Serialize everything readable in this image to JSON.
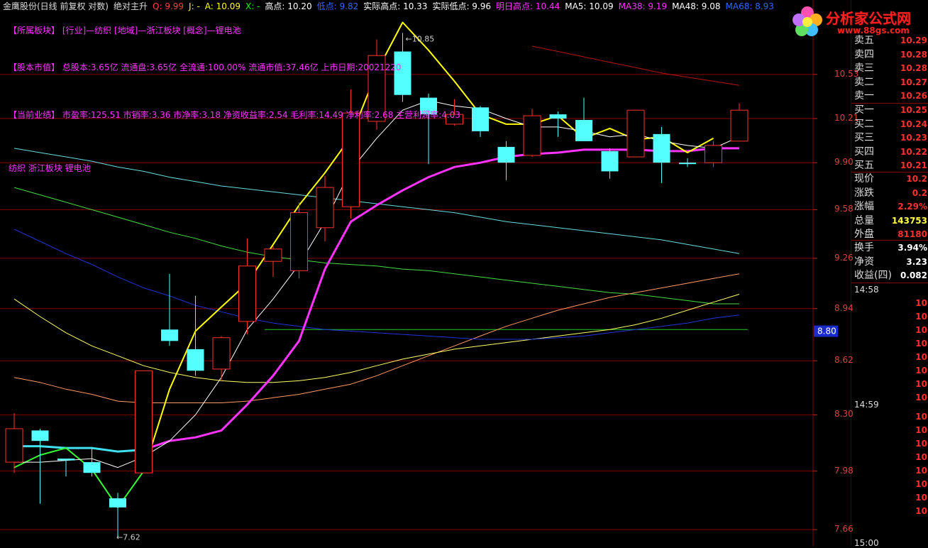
{
  "window": {
    "title": "金鹰股份(日线 前复权 对数)",
    "indicator": "绝对主升"
  },
  "legend": [
    {
      "text": "Q: 9.99",
      "color": "#ff4040"
    },
    {
      "text": "J: -",
      "color": "#ffff00"
    },
    {
      "text": "A: 10.09",
      "color": "#ffff00"
    },
    {
      "text": "X: -",
      "color": "#00ff00"
    },
    {
      "text": "高点: 10.20",
      "color": "#ffffff"
    },
    {
      "text": "低点: 9.82",
      "color": "#3366ff"
    },
    {
      "text": "实际高点: 10.33",
      "color": "#ffffff"
    },
    {
      "text": "实际低点: 9.96",
      "color": "#ffffff"
    },
    {
      "text": "明日高点: 10.44",
      "color": "#ff33ff"
    },
    {
      "text": "MA5: 10.09",
      "color": "#ffffff"
    },
    {
      "text": "MA38: 9.19",
      "color": "#ff33ff"
    },
    {
      "text": "MA48: 9.08",
      "color": "#ffffff"
    },
    {
      "text": "MA68: 8.93",
      "color": "#3366ff"
    }
  ],
  "info": [
    "【所属板块】 [行业]—纺织 [地域]—浙江板块 [概念]—锂电池",
    "【股本市值】 总股本:3.65亿 流通盘:3.65亿 全流通:100.00% 流通市值:37.46亿 上市日期:20021220",
    "【当前业绩】 市盈率:125.51 市销率:3.36 市净率:3.18 净资收益率:2.54 毛利率:14.49 净利率:2.68 主营利润率:4.03",
    "纺织 浙江板块 锂电池"
  ],
  "price_axis": {
    "ticks": [
      "10.53",
      "10.21",
      "9.90",
      "9.58",
      "9.26",
      "8.94",
      "8.62",
      "8.30",
      "7.98",
      "7.66"
    ],
    "current": "8.80"
  },
  "annotations": {
    "high": "10.85",
    "low": "7.62"
  },
  "side_panel": {
    "asks": [
      {
        "label": "卖五",
        "value": "10.29"
      },
      {
        "label": "卖四",
        "value": "10.28"
      },
      {
        "label": "卖三",
        "value": "10.28"
      },
      {
        "label": "卖二",
        "value": "10.27"
      },
      {
        "label": "卖一",
        "value": "10.26"
      }
    ],
    "bids": [
      {
        "label": "买一",
        "value": "10.25"
      },
      {
        "label": "买二",
        "value": "10.24"
      },
      {
        "label": "买三",
        "value": "10.23"
      },
      {
        "label": "买四",
        "value": "10.22"
      },
      {
        "label": "买五",
        "value": "10.21"
      }
    ],
    "stats": [
      {
        "label": "现价",
        "value": "10.2"
      },
      {
        "label": "涨跌",
        "value": "0.2"
      },
      {
        "label": "涨幅",
        "value": "2.29%"
      },
      {
        "label": "总量",
        "value": "143753"
      },
      {
        "label": "外盘",
        "value": "81180"
      },
      {
        "label": "换手",
        "value": "3.94%"
      },
      {
        "label": "净资",
        "value": "3.23"
      },
      {
        "label": "收益(四)",
        "value": "0.082"
      }
    ],
    "time1": "14:58",
    "time2": "14:59",
    "time3": "15:00",
    "ticks": [
      "10",
      "10",
      "10",
      "10",
      "10",
      "10",
      "10",
      "10",
      "10",
      "10",
      "10",
      "10",
      "10",
      "10",
      "10",
      "10",
      "10",
      "10",
      "10",
      "10"
    ]
  },
  "logo": {
    "title": "分析家公式网",
    "url": "www.88gs.com"
  },
  "colors": {
    "up": "#ff3030",
    "down": "#54ffff",
    "ma5": "#ffffff",
    "ma_main": "#ffff00",
    "ma38": "#ff33ff",
    "grid": "#8b0000"
  },
  "chart_data": {
    "type": "candlestick",
    "yscale": "log",
    "ylim": [
      7.6,
      10.95
    ],
    "candles": [
      {
        "o": 8.03,
        "h": 8.31,
        "l": 7.97,
        "c": 8.22,
        "up": true
      },
      {
        "o": 8.21,
        "h": 8.22,
        "l": 7.8,
        "c": 8.15,
        "up": false
      },
      {
        "o": 8.05,
        "h": 8.05,
        "l": 7.95,
        "c": 8.04,
        "up": false
      },
      {
        "o": 8.03,
        "h": 8.11,
        "l": 7.95,
        "c": 7.97,
        "up": false
      },
      {
        "o": 7.83,
        "h": 7.86,
        "l": 7.62,
        "c": 7.78,
        "up": false
      },
      {
        "o": 7.97,
        "h": 8.56,
        "l": 7.97,
        "c": 8.56,
        "up": true
      },
      {
        "o": 8.81,
        "h": 9.16,
        "l": 8.71,
        "c": 8.74,
        "up": false
      },
      {
        "o": 8.69,
        "h": 9.02,
        "l": 8.53,
        "c": 8.56,
        "up": false
      },
      {
        "o": 8.57,
        "h": 8.77,
        "l": 8.5,
        "c": 8.76,
        "up": true
      },
      {
        "o": 8.86,
        "h": 9.39,
        "l": 8.78,
        "c": 9.21,
        "up": true
      },
      {
        "o": 9.24,
        "h": 9.34,
        "l": 9.14,
        "c": 9.32,
        "up": true
      },
      {
        "o": 9.18,
        "h": 9.63,
        "l": 9.13,
        "c": 9.56,
        "up": true
      },
      {
        "o": 9.46,
        "h": 9.81,
        "l": 9.37,
        "c": 9.73,
        "up": true
      },
      {
        "o": 9.6,
        "h": 10.42,
        "l": 9.52,
        "c": 10.25,
        "up": true
      },
      {
        "o": 10.19,
        "h": 10.79,
        "l": 10.13,
        "c": 10.67,
        "up": true
      },
      {
        "o": 10.7,
        "h": 10.84,
        "l": 10.33,
        "c": 10.38,
        "up": false
      },
      {
        "o": 10.36,
        "h": 10.39,
        "l": 9.89,
        "c": 10.24,
        "up": false
      },
      {
        "o": 10.24,
        "h": 10.35,
        "l": 10.16,
        "c": 10.17,
        "up": true
      },
      {
        "o": 10.29,
        "h": 10.3,
        "l": 10.08,
        "c": 10.12,
        "up": false
      },
      {
        "o": 10.01,
        "h": 10.05,
        "l": 9.78,
        "c": 9.9,
        "up": false
      },
      {
        "o": 9.95,
        "h": 10.28,
        "l": 9.94,
        "c": 10.23,
        "up": true
      },
      {
        "o": 10.24,
        "h": 10.26,
        "l": 10.08,
        "c": 10.21,
        "up": false
      },
      {
        "o": 10.2,
        "h": 10.36,
        "l": 10.08,
        "c": 10.05,
        "up": false
      },
      {
        "o": 9.98,
        "h": 10.0,
        "l": 9.79,
        "c": 9.84,
        "up": false
      },
      {
        "o": 10.27,
        "h": 10.27,
        "l": 9.94,
        "c": 9.94,
        "up": true
      },
      {
        "o": 10.1,
        "h": 10.15,
        "l": 9.76,
        "c": 9.9,
        "up": false
      },
      {
        "o": 9.9,
        "h": 9.93,
        "l": 9.87,
        "c": 9.89,
        "up": false
      },
      {
        "o": 9.9,
        "h": 10.05,
        "l": 9.87,
        "c": 10.02,
        "up": true
      },
      {
        "o": 10.05,
        "h": 10.32,
        "l": 10.05,
        "c": 10.27,
        "up": true
      }
    ],
    "lines": [
      {
        "name": "MA5",
        "color": "#ffffff",
        "width": 1,
        "values": [
          8.03,
          8.03,
          8.04,
          8.05,
          8.0,
          8.06,
          8.15,
          8.3,
          8.52,
          8.81,
          9.0,
          9.22,
          9.5,
          9.85,
          10.07,
          10.27,
          10.34,
          10.3,
          10.28,
          10.21,
          10.15,
          10.15,
          10.12,
          10.08,
          10.1,
          10.05,
          10.02,
          10.0,
          10.08
        ]
      },
      {
        "name": "主升线",
        "color": "#ffff00",
        "width": 2,
        "values": [
          null,
          null,
          null,
          null,
          null,
          7.98,
          8.45,
          8.8,
          8.95,
          9.1,
          9.35,
          9.61,
          9.83,
          10.08,
          10.55,
          10.92,
          10.71,
          10.48,
          10.24,
          10.17,
          10.17,
          10.23,
          10.07,
          10.14,
          10.06,
          10.08,
          9.97,
          10.07,
          null
        ]
      },
      {
        "name": "MA38",
        "color": "#ff33ff",
        "width": 3,
        "values": [
          null,
          null,
          null,
          null,
          null,
          8.1,
          8.15,
          8.17,
          8.21,
          8.36,
          8.53,
          8.74,
          9.19,
          9.5,
          9.61,
          9.71,
          9.8,
          9.87,
          9.9,
          9.94,
          9.96,
          9.97,
          9.99,
          9.99,
          9.99,
          9.98,
          9.98,
          10.0,
          10.0
        ]
      },
      {
        "name": "绿线",
        "color": "#33ff33",
        "width": 2,
        "values": [
          8.0,
          8.07,
          8.11,
          7.99,
          7.78,
          7.98,
          null,
          null,
          null,
          null,
          null,
          null,
          null,
          null,
          null,
          null,
          null,
          null,
          null,
          null,
          null,
          null,
          null,
          null,
          null,
          null,
          null,
          null,
          null
        ]
      },
      {
        "name": "青线",
        "color": "#40e0f0",
        "width": 3,
        "values": [
          8.12,
          8.12,
          8.11,
          8.11,
          8.09,
          8.1,
          null,
          null,
          null,
          null,
          null,
          null,
          null,
          null,
          null,
          null,
          null,
          null,
          null,
          null,
          null,
          null,
          null,
          null,
          null,
          null,
          null,
          null,
          null
        ]
      },
      {
        "name": "MA68",
        "color": "#2233dd",
        "width": 1,
        "values": [
          9.45,
          9.37,
          9.29,
          9.22,
          9.14,
          9.07,
          9.02,
          8.96,
          8.92,
          8.88,
          8.85,
          8.83,
          8.81,
          8.8,
          8.79,
          8.78,
          8.77,
          8.76,
          8.75,
          8.75,
          8.75,
          8.76,
          8.77,
          8.79,
          8.81,
          8.83,
          8.85,
          8.88,
          8.9
        ]
      },
      {
        "name": "MA48",
        "color": "#ffff66",
        "width": 1,
        "values": [
          9.0,
          8.89,
          8.79,
          8.71,
          8.65,
          8.59,
          8.55,
          8.52,
          8.5,
          8.49,
          8.49,
          8.5,
          8.52,
          8.55,
          8.59,
          8.63,
          8.66,
          8.69,
          8.71,
          8.73,
          8.75,
          8.77,
          8.79,
          8.81,
          8.84,
          8.88,
          8.93,
          8.98,
          9.03
        ]
      },
      {
        "name": "橙线",
        "color": "#ff9966",
        "width": 1,
        "values": [
          8.52,
          8.49,
          8.45,
          8.42,
          8.38,
          8.37,
          8.37,
          8.37,
          8.37,
          8.38,
          8.4,
          8.42,
          8.45,
          8.48,
          8.53,
          8.59,
          8.65,
          8.71,
          8.77,
          8.83,
          8.88,
          8.93,
          8.97,
          9.01,
          9.04,
          9.07,
          9.1,
          9.13,
          9.16
        ]
      },
      {
        "name": "中线",
        "color": "#44dd44",
        "width": 1,
        "values": [
          9.73,
          9.68,
          9.63,
          9.58,
          9.53,
          9.48,
          9.43,
          9.39,
          9.34,
          9.3,
          9.27,
          9.25,
          9.23,
          9.22,
          9.21,
          9.19,
          9.18,
          9.16,
          9.14,
          9.12,
          9.1,
          9.08,
          9.06,
          9.04,
          9.03,
          9.01,
          8.99,
          8.97,
          8.97
        ]
      },
      {
        "name": "长线",
        "color": "#66dddd",
        "width": 1,
        "values": [
          10.0,
          9.97,
          9.94,
          9.91,
          9.87,
          9.84,
          9.8,
          9.77,
          9.74,
          9.72,
          9.7,
          9.68,
          9.66,
          9.64,
          9.62,
          9.6,
          9.58,
          9.56,
          9.53,
          9.5,
          9.48,
          9.46,
          9.44,
          9.42,
          9.4,
          9.38,
          9.35,
          9.32,
          9.29
        ]
      },
      {
        "name": "年线",
        "color": "#bb1111",
        "width": 1,
        "values": [
          null,
          null,
          null,
          null,
          null,
          null,
          null,
          null,
          null,
          null,
          null,
          null,
          null,
          null,
          null,
          null,
          null,
          null,
          null,
          null,
          10.74,
          10.7,
          10.66,
          10.62,
          10.58,
          10.54,
          10.51,
          10.48,
          10.45
        ]
      }
    ],
    "hline": {
      "value": 8.81,
      "color": "#22cc22",
      "from": 10,
      "to": 28
    }
  }
}
